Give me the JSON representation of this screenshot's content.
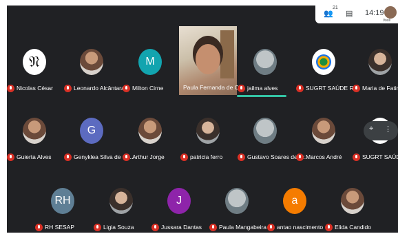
{
  "topbar": {
    "people_icon": "people-icon",
    "people_count": "21",
    "chat_icon": "chat-icon",
    "time": "14:19",
    "user_label": "Você"
  },
  "active_speaker": {
    "name": "Paula Fernanda de C..."
  },
  "participants": [
    {
      "name": "Nicolas César",
      "avatar": {
        "type": "logo",
        "letter": "𝔑"
      }
    },
    {
      "name": "Leonardo Alcântara",
      "avatar": {
        "type": "photo"
      }
    },
    {
      "name": "Milton Cirne",
      "avatar": {
        "type": "initial",
        "letter": "M",
        "color": "#12a4af"
      }
    },
    {
      "name": "jailma alves",
      "avatar": {
        "type": "photo3"
      }
    },
    {
      "name": "SUGRT SAÚDE RN",
      "avatar": {
        "type": "seal"
      }
    },
    {
      "name": "Maria de Fatima F...",
      "avatar": {
        "type": "photo2"
      }
    },
    {
      "name": "Guierta Alves",
      "avatar": {
        "type": "photo"
      }
    },
    {
      "name": "Genyklea Silva de Oli...",
      "avatar": {
        "type": "initial",
        "letter": "G",
        "color": "#5c6bc0"
      }
    },
    {
      "name": "Arthur Jorge",
      "avatar": {
        "type": "photo"
      }
    },
    {
      "name": "patricia ferro",
      "avatar": {
        "type": "photo2"
      }
    },
    {
      "name": "Gustavo Soares de Ar...",
      "avatar": {
        "type": "photo3"
      }
    },
    {
      "name": "Marcos André",
      "avatar": {
        "type": "photo"
      }
    },
    {
      "name": "SUGRT SAÚDE RN",
      "avatar": {
        "type": "seal"
      }
    },
    {
      "name": "RH SESAP",
      "avatar": {
        "type": "initial",
        "letter": "RH",
        "color": "#5f7f95"
      }
    },
    {
      "name": "Ligia Souza",
      "avatar": {
        "type": "photo2"
      }
    },
    {
      "name": "Jussara Dantas",
      "avatar": {
        "type": "initial",
        "letter": "J",
        "color": "#8e24aa"
      }
    },
    {
      "name": "Paula Mangabeira",
      "avatar": {
        "type": "photo3"
      }
    },
    {
      "name": "antao nascimento",
      "avatar": {
        "type": "initial",
        "letter": "a",
        "color": "#f57c00"
      }
    },
    {
      "name": "Elida Candido",
      "avatar": {
        "type": "photo"
      }
    }
  ],
  "colors": {
    "background": "#202124",
    "muted_mic": "#d93025",
    "speaking_bar": "#34c3a4"
  }
}
